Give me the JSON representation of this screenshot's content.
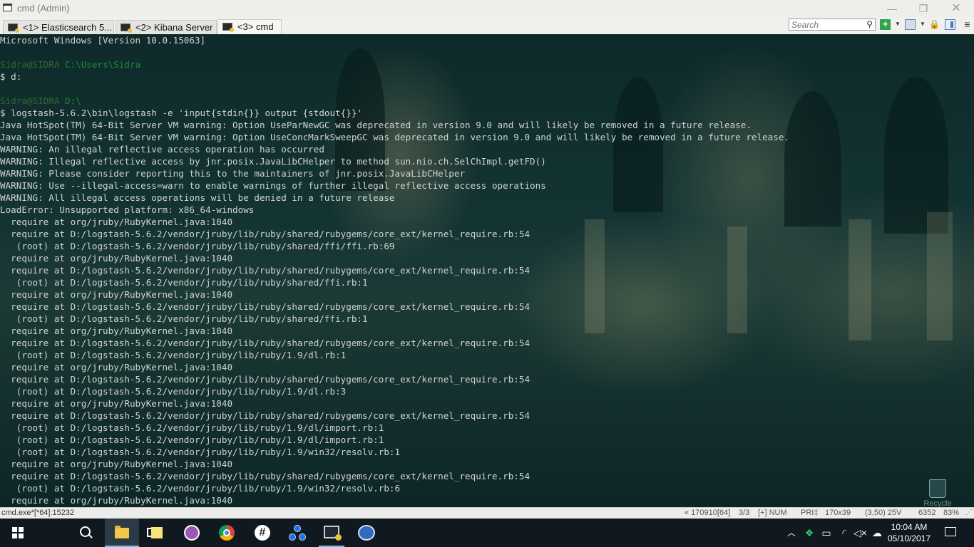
{
  "window": {
    "title": "cmd (Admin)",
    "controls": {
      "minimize": "—",
      "maximize": "❐",
      "close": "✕"
    }
  },
  "tabs": [
    {
      "label": "<1> Elasticsearch 5...",
      "icon": "console-tab-icon",
      "active": false
    },
    {
      "label": "<2> Kibana Server",
      "icon": "console-tab-icon",
      "active": false
    },
    {
      "label": "<3> cmd",
      "icon": "console-tab-icon",
      "active": true
    }
  ],
  "search": {
    "placeholder": "Search"
  },
  "toolbar": {
    "add_label": "+",
    "menu_label": "≡"
  },
  "console": {
    "lines": [
      {
        "text": "Microsoft Windows [Version 10.0.15063]"
      },
      {
        "text": ""
      },
      {
        "user": "Sidra@SIDRA",
        "path": "C:\\Users\\Sidra"
      },
      {
        "text": "$ d:"
      },
      {
        "text": ""
      },
      {
        "user": "Sidra@SIDRA",
        "path": "D:\\"
      },
      {
        "text": "$ logstash-5.6.2\\bin\\logstash -e 'input{stdin{}} output {stdout{}}'"
      },
      {
        "text": "Java HotSpot(TM) 64-Bit Server VM warning: Option UseParNewGC was deprecated in version 9.0 and will likely be removed in a future release."
      },
      {
        "text": "Java HotSpot(TM) 64-Bit Server VM warning: Option UseConcMarkSweepGC was deprecated in version 9.0 and will likely be removed in a future release."
      },
      {
        "text": "WARNING: An illegal reflective access operation has occurred"
      },
      {
        "text": "WARNING: Illegal reflective access by jnr.posix.JavaLibCHelper to method sun.nio.ch.SelChImpl.getFD()"
      },
      {
        "text": "WARNING: Please consider reporting this to the maintainers of jnr.posix.JavaLibCHelper"
      },
      {
        "text": "WARNING: Use --illegal-access=warn to enable warnings of further illegal reflective access operations"
      },
      {
        "text": "WARNING: All illegal access operations will be denied in a future release"
      },
      {
        "text": "LoadError: Unsupported platform: x86_64-windows"
      },
      {
        "text": "  require at org/jruby/RubyKernel.java:1040"
      },
      {
        "text": "  require at D:/logstash-5.6.2/vendor/jruby/lib/ruby/shared/rubygems/core_ext/kernel_require.rb:54"
      },
      {
        "text": "   (root) at D:/logstash-5.6.2/vendor/jruby/lib/ruby/shared/ffi/ffi.rb:69"
      },
      {
        "text": "  require at org/jruby/RubyKernel.java:1040"
      },
      {
        "text": "  require at D:/logstash-5.6.2/vendor/jruby/lib/ruby/shared/rubygems/core_ext/kernel_require.rb:54"
      },
      {
        "text": "   (root) at D:/logstash-5.6.2/vendor/jruby/lib/ruby/shared/ffi.rb:1"
      },
      {
        "text": "  require at org/jruby/RubyKernel.java:1040"
      },
      {
        "text": "  require at D:/logstash-5.6.2/vendor/jruby/lib/ruby/shared/rubygems/core_ext/kernel_require.rb:54"
      },
      {
        "text": "   (root) at D:/logstash-5.6.2/vendor/jruby/lib/ruby/shared/ffi.rb:1"
      },
      {
        "text": "  require at org/jruby/RubyKernel.java:1040"
      },
      {
        "text": "  require at D:/logstash-5.6.2/vendor/jruby/lib/ruby/shared/rubygems/core_ext/kernel_require.rb:54"
      },
      {
        "text": "   (root) at D:/logstash-5.6.2/vendor/jruby/lib/ruby/1.9/dl.rb:1"
      },
      {
        "text": "  require at org/jruby/RubyKernel.java:1040"
      },
      {
        "text": "  require at D:/logstash-5.6.2/vendor/jruby/lib/ruby/shared/rubygems/core_ext/kernel_require.rb:54"
      },
      {
        "text": "   (root) at D:/logstash-5.6.2/vendor/jruby/lib/ruby/1.9/dl.rb:3"
      },
      {
        "text": "  require at org/jruby/RubyKernel.java:1040"
      },
      {
        "text": "  require at D:/logstash-5.6.2/vendor/jruby/lib/ruby/shared/rubygems/core_ext/kernel_require.rb:54"
      },
      {
        "text": "   (root) at D:/logstash-5.6.2/vendor/jruby/lib/ruby/1.9/dl/import.rb:1"
      },
      {
        "text": "   (root) at D:/logstash-5.6.2/vendor/jruby/lib/ruby/1.9/dl/import.rb:1"
      },
      {
        "text": "   (root) at D:/logstash-5.6.2/vendor/jruby/lib/ruby/1.9/win32/resolv.rb:1"
      },
      {
        "text": "  require at org/jruby/RubyKernel.java:1040"
      },
      {
        "text": "  require at D:/logstash-5.6.2/vendor/jruby/lib/ruby/shared/rubygems/core_ext/kernel_require.rb:54"
      },
      {
        "text": "   (root) at D:/logstash-5.6.2/vendor/jruby/lib/ruby/1.9/win32/resolv.rb:6"
      },
      {
        "text": "  require at org/jruby/RubyKernel.java:1040"
      }
    ]
  },
  "desktop": {
    "recycle_bin_label": "Recycle Bin"
  },
  "statusbar": {
    "left": "cmd.exe*[*64]:15232",
    "items": [
      "« 170910[64]",
      "3/3",
      "[+] NUM",
      "PRI‡",
      "170x39",
      "(3,50) 25V",
      "6352",
      "83%"
    ]
  },
  "taskbar": {
    "apps": [
      {
        "name": "file-explorer-icon",
        "active": true
      },
      {
        "name": "sticky-notes-icon",
        "active": false
      },
      {
        "name": "github-desktop-icon",
        "active": false
      },
      {
        "name": "chrome-icon",
        "active": false
      },
      {
        "name": "slack-icon",
        "active": false
      },
      {
        "name": "app-nodes-icon",
        "active": false
      },
      {
        "name": "cmder-icon",
        "active": false
      },
      {
        "name": "thunderbird-icon",
        "active": false
      }
    ],
    "clock": {
      "time": "10:04 AM",
      "date": "05/10/2017"
    }
  },
  "colors": {
    "titlebar_bg": "#eeeeea",
    "console_text": "#d2d2d2",
    "prompt_user": "#2d6a2d",
    "prompt_path": "#1f8a3a",
    "taskbar_bg": "#10191f",
    "accent": "#76b9ed"
  }
}
